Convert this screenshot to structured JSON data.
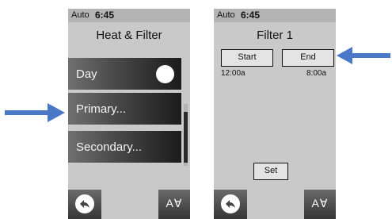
{
  "left_screen": {
    "status": {
      "mode": "Auto",
      "time": "6:45"
    },
    "title": "Heat & Filter",
    "menu": [
      {
        "label": "Day",
        "toggle": "on"
      },
      {
        "label": "Primary..."
      },
      {
        "label": "Secondary..."
      }
    ],
    "bottom": {
      "back_icon": "back-arrow-icon",
      "arrows_label": "A∀"
    }
  },
  "right_screen": {
    "status": {
      "mode": "Auto",
      "time": "6:45"
    },
    "title": "Filter 1",
    "start_label": "Start",
    "end_label": "End",
    "start_time": "12:00a",
    "end_time": "8:00a",
    "set_label": "Set",
    "bottom": {
      "back_icon": "back-arrow-icon",
      "arrows_label": "A∀"
    }
  },
  "colors": {
    "callout_arrow": "#4a78c8",
    "screen_bg": "#c9c9c9"
  }
}
